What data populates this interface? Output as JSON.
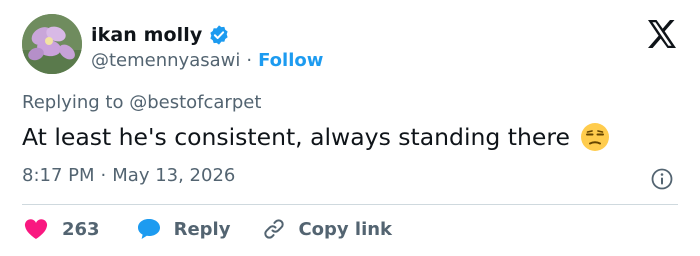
{
  "author": {
    "display_name": "ikan molly",
    "handle": "@temennyasawi",
    "separator": "·",
    "follow_label": "Follow",
    "verified_color": "#1d9bf0"
  },
  "reply_context": {
    "prefix": "Replying to ",
    "mention": "@bestofcarpet"
  },
  "tweet": {
    "text": "At least he's consistent, always standing there",
    "emoji": "unamused-face-emoji",
    "time": "8:17 PM",
    "separator": "·",
    "date": "May 13, 2026"
  },
  "actions": {
    "like_count": "263",
    "like_color": "#f91880",
    "reply_label": "Reply",
    "reply_color": "#1d9bf0",
    "copy_label": "Copy link"
  },
  "icons": {
    "brand": "x-logo-icon",
    "info": "info-icon",
    "like": "heart-icon",
    "reply": "reply-bubble-icon",
    "copy": "link-icon",
    "verified": "verified-badge-icon"
  }
}
